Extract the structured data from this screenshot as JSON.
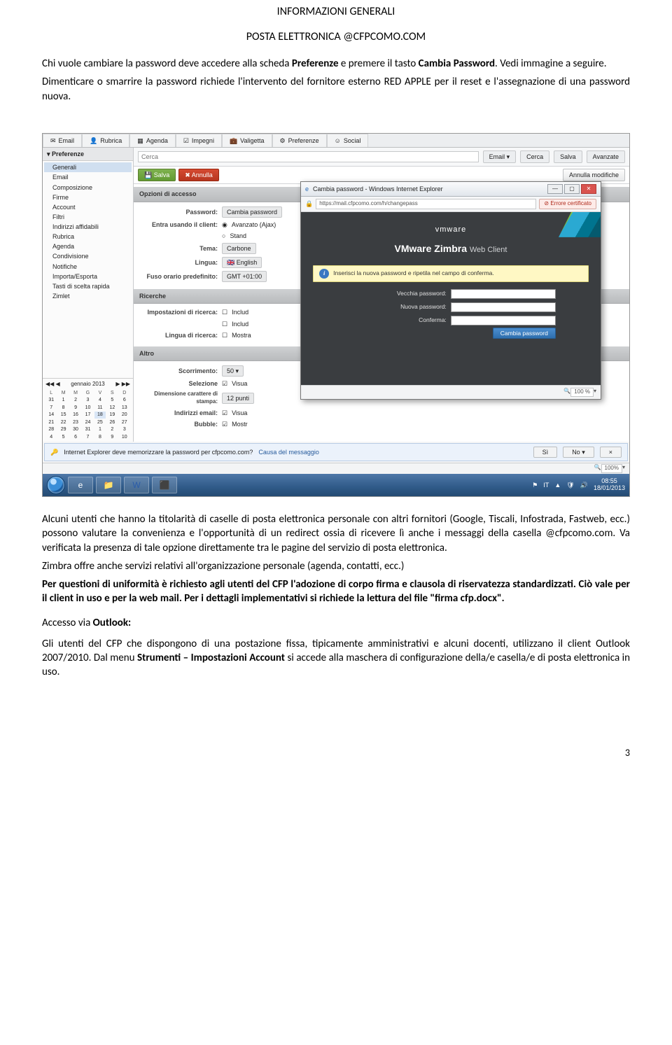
{
  "header": {
    "title1": "INFORMAZIONI GENERALI",
    "title2": "POSTA ELETTRONICA @CFPCOMO.COM"
  },
  "intro": {
    "p1a": "Chi vuole cambiare la password deve accedere alla scheda ",
    "p1b": "Preferenze",
    "p1c": " e premere il tasto ",
    "p1d": "Cambia Password",
    "p1e": ". Vedi immagine a seguire.",
    "p2": "Dimenticare o smarrire la password richiede l'intervento del fornitore esterno RED APPLE per il reset e l'assegnazione di una password nuova."
  },
  "screenshot": {
    "tabs": [
      "Email",
      "Rubrica",
      "Agenda",
      "Impegni",
      "Valigetta",
      "Preferenze",
      "Social"
    ],
    "sidebar": {
      "header": "Preferenze",
      "items": [
        {
          "label": "Generali",
          "selected": true
        },
        {
          "label": "Email",
          "selected": false
        },
        {
          "label": "Composizione",
          "selected": false
        },
        {
          "label": "Firme",
          "selected": false
        },
        {
          "label": "Account",
          "selected": false
        },
        {
          "label": "Filtri",
          "selected": false
        },
        {
          "label": "Indirizzi affidabili",
          "selected": false
        },
        {
          "label": "Rubrica",
          "selected": false
        },
        {
          "label": "Agenda",
          "selected": false
        },
        {
          "label": "Condivisione",
          "selected": false
        },
        {
          "label": "Notifiche",
          "selected": false
        },
        {
          "label": "Importa/Esporta",
          "selected": false
        },
        {
          "label": "Tasti di scelta rapida",
          "selected": false
        },
        {
          "label": "Zimlet",
          "selected": false
        }
      ],
      "calendar": {
        "nav_prev": "◀◀ ◀",
        "title": "gennaio 2013",
        "nav_next": "▶ ▶▶",
        "days_header": [
          "L",
          "M",
          "M",
          "G",
          "V",
          "S",
          "D"
        ],
        "weeks": [
          [
            "31",
            "1",
            "2",
            "3",
            "4",
            "5",
            "6"
          ],
          [
            "7",
            "8",
            "9",
            "10",
            "11",
            "12",
            "13"
          ],
          [
            "14",
            "15",
            "16",
            "17",
            "18",
            "19",
            "20"
          ],
          [
            "21",
            "22",
            "23",
            "24",
            "25",
            "26",
            "27"
          ],
          [
            "28",
            "29",
            "30",
            "31",
            "1",
            "2",
            "3"
          ],
          [
            "4",
            "5",
            "6",
            "7",
            "8",
            "9",
            "10"
          ]
        ],
        "today": "18"
      }
    },
    "search": {
      "placeholder": "Cerca",
      "menu": "Email ▾",
      "btn_search": "Cerca",
      "btn_save": "Salva",
      "btn_adv": "Avanzate"
    },
    "actionbar": {
      "save": "Salva",
      "cancel": "Annulla",
      "undo_changes": "Annulla modifiche"
    },
    "panels": {
      "access": {
        "title": "Opzioni di accesso",
        "rows": {
          "password_label": "Password:",
          "password_btn": "Cambia password",
          "client_label": "Entra usando il client:",
          "client_opt1": "Avanzato (Ajax)",
          "client_opt2": "Stand",
          "theme_label": "Tema:",
          "theme_value": "Carbone",
          "lang_label": "Lingua:",
          "lang_value": "English",
          "tz_label": "Fuso orario predefinito:",
          "tz_value": "GMT +01:00"
        }
      },
      "search_opts": {
        "title": "Ricerche",
        "impost_label": "Impostazioni di ricerca:",
        "impost_opt1": "Includ",
        "impost_opt2": "Includ",
        "lang_label": "Lingua di ricerca:",
        "lang_opt": "Mostra"
      },
      "other": {
        "title": "Altro",
        "scroll_label": "Scorrimento:",
        "scroll_value": "50",
        "sel_label": "Selezione",
        "sel_opt": "Visua",
        "print_size_label": "Dimensione carattere di stampa:",
        "print_size_value": "12 punti",
        "email_addr_label": "Indirizzi email:",
        "email_addr_opt": "Visua",
        "bubble_label": "Bubble:",
        "bubble_opt": "Mostr"
      }
    },
    "popup": {
      "title": "Cambia password - Windows Internet Explorer",
      "url": "https://mail.cfpcomo.com/h/changepass",
      "cert_error": "Errore certificato",
      "vmware": "vmware",
      "zimbra_a": "VMware Zimbra",
      "zimbra_b": "Web Client",
      "info": "Inserisci la nuova password e ripetila nel campo di conferma.",
      "old_pw": "Vecchia password:",
      "new_pw": "Nuova password:",
      "confirm": "Conferma:",
      "change_btn": "Cambia password",
      "zoom": "100 %"
    },
    "ie_bar": {
      "msg": "Internet Explorer deve memorizzare la password per cfpcomo.com?",
      "link": "Causa del messaggio",
      "yes": "Sì",
      "no": "No",
      "close": "×"
    },
    "main_zoom": "100%",
    "taskbar": {
      "lang": "IT",
      "time": "08:55",
      "date": "18/01/2013"
    }
  },
  "body_after": {
    "p1": "Alcuni utenti che hanno la titolarità di caselle di posta elettronica personale con altri fornitori (Google, Tiscali, Infostrada, Fastweb, ecc.) possono valutare la convenienza e l'opportunità di un redirect ossia di ricevere lì anche i messaggi della casella @cfpcomo.com. Va verificata la presenza di tale opzione direttamente tra le pagine del servizio di posta elettronica.",
    "p2": "Zimbra offre anche servizi relativi all'organizzazione personale (agenda, contatti, ecc.)",
    "p3": "Per questioni di uniformità è richiesto agli utenti del CFP l'adozione di corpo firma e clausola di riservatezza standardizzati. Ciò vale per il client in uso e per la web mail. Per i dettagli implementativi si richiede la lettura del file \"firma cfp.docx\".",
    "outlook_pre": "Accesso via ",
    "outlook_b": "Outlook:",
    "p4a": "Gli utenti del CFP che dispongono di una postazione fissa, tipicamente amministrativi e alcuni docenti, utilizzano il client Outlook 2007/2010. Dal menu ",
    "p4b": "Strumenti – Impostazioni Account",
    "p4c": " si accede alla maschera di configurazione della/e casella/e di posta elettronica in uso."
  },
  "page_number": "3"
}
